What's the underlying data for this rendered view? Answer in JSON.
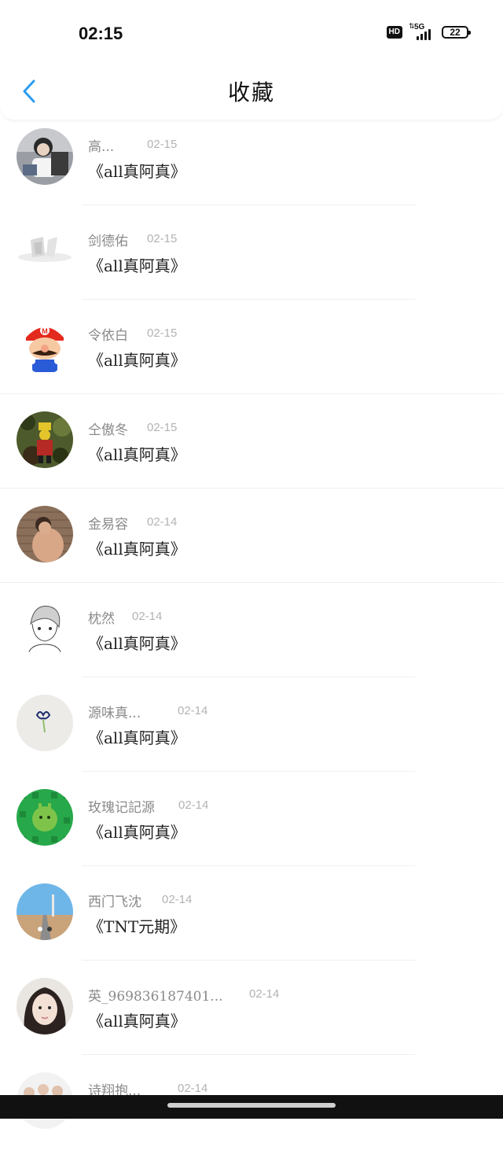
{
  "status_bar": {
    "time": "02:15",
    "hd": "HD",
    "network": "5G",
    "battery": "22"
  },
  "header": {
    "title": "收藏",
    "back_icon": "chevron-left-icon",
    "accent_color": "#2d9cf0"
  },
  "items": [
    {
      "name": "高...",
      "date": "02-15",
      "title": "《all真阿真》"
    },
    {
      "name": "剑德佑",
      "date": "02-15",
      "title": "《all真阿真》"
    },
    {
      "name": "令依白",
      "date": "02-15",
      "title": "《all真阿真》"
    },
    {
      "name": "仝傲冬",
      "date": "02-15",
      "title": "《all真阿真》"
    },
    {
      "name": "金易容",
      "date": "02-14",
      "title": "《all真阿真》"
    },
    {
      "name": "枕然",
      "date": "02-14",
      "title": "《all真阿真》"
    },
    {
      "name": "源味真...",
      "date": "02-14",
      "title": "《all真阿真》"
    },
    {
      "name": "玫瑰记記源",
      "date": "02-14",
      "title": "《all真阿真》"
    },
    {
      "name": "西门飞沈",
      "date": "02-14",
      "title": "《TNT元期》"
    },
    {
      "name": "英_969836187401...",
      "date": "02-14",
      "title": "《all真阿真》"
    },
    {
      "name": "诗翔抱...",
      "date": "02-14",
      "title": ""
    }
  ]
}
